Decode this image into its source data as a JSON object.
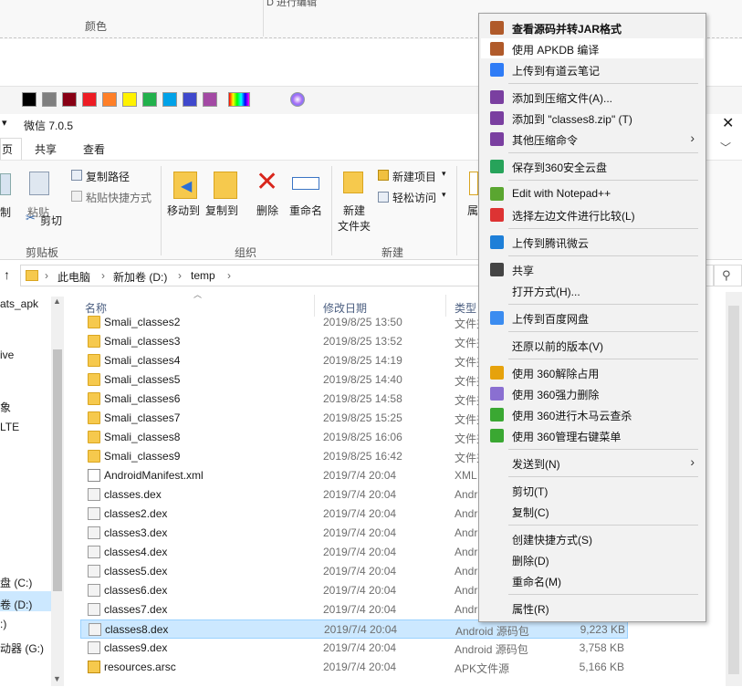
{
  "paint": {
    "colors_label": "颜色",
    "edit3d_label": "D 进行编辑",
    "palette": [
      "#000000",
      "#7f7f7f",
      "#880015",
      "#ed1c24",
      "#ff7f27",
      "#fff200",
      "#22b14c",
      "#00a2e8",
      "#3f48cc",
      "#a349a4"
    ]
  },
  "explorer": {
    "title": "微信 7.0.5",
    "tabs": [
      "页",
      "共享",
      "查看"
    ],
    "ribbon": {
      "clipboard": {
        "pin_label": "制",
        "paste_label": "粘贴",
        "copy_path": "复制路径",
        "paste_shortcut": "粘贴快捷方式",
        "cut": "剪切",
        "group": "剪贴板"
      },
      "organize": {
        "move_to": "移动到",
        "copy_to": "复制到",
        "delete": "删除",
        "rename": "重命名",
        "group": "组织"
      },
      "new": {
        "new_folder": [
          "新建",
          "文件夹"
        ],
        "new_item": "新建项目",
        "easy_access": "轻松访问",
        "group": "新建",
        "prop_label": "属"
      }
    },
    "address": {
      "crumbs": [
        "此电脑",
        "新加卷 (D:)",
        "temp"
      ]
    },
    "nav": [
      "ats_apk",
      "ive",
      "象",
      "LTE",
      "盘 (C:)",
      "卷 (D:)",
      ":)",
      "动器 (G:)"
    ],
    "columns": {
      "name": "名称",
      "date": "修改日期",
      "type": "类型"
    },
    "files": [
      {
        "name": "Smali_classes2",
        "date": "2019/8/25 13:50",
        "type": "文件夹",
        "size": "",
        "kind": "folder"
      },
      {
        "name": "Smali_classes3",
        "date": "2019/8/25 13:52",
        "type": "文件夹",
        "size": "",
        "kind": "folder"
      },
      {
        "name": "Smali_classes4",
        "date": "2019/8/25 14:19",
        "type": "文件夹",
        "size": "",
        "kind": "folder"
      },
      {
        "name": "Smali_classes5",
        "date": "2019/8/25 14:40",
        "type": "文件夹",
        "size": "",
        "kind": "folder"
      },
      {
        "name": "Smali_classes6",
        "date": "2019/8/25 14:58",
        "type": "文件夹",
        "size": "",
        "kind": "folder"
      },
      {
        "name": "Smali_classes7",
        "date": "2019/8/25 15:25",
        "type": "文件夹",
        "size": "",
        "kind": "folder"
      },
      {
        "name": "Smali_classes8",
        "date": "2019/8/25 16:06",
        "type": "文件夹",
        "size": "",
        "kind": "folder"
      },
      {
        "name": "Smali_classes9",
        "date": "2019/8/25 16:42",
        "type": "文件夹",
        "size": "",
        "kind": "folder"
      },
      {
        "name": "AndroidManifest.xml",
        "date": "2019/7/4 20:04",
        "type": "XML",
        "size": "",
        "kind": "xml"
      },
      {
        "name": "classes.dex",
        "date": "2019/7/4 20:04",
        "type": "Andr",
        "size": "",
        "kind": "file"
      },
      {
        "name": "classes2.dex",
        "date": "2019/7/4 20:04",
        "type": "Andr",
        "size": "",
        "kind": "file"
      },
      {
        "name": "classes3.dex",
        "date": "2019/7/4 20:04",
        "type": "Andr",
        "size": "",
        "kind": "file"
      },
      {
        "name": "classes4.dex",
        "date": "2019/7/4 20:04",
        "type": "Andr",
        "size": "",
        "kind": "file"
      },
      {
        "name": "classes5.dex",
        "date": "2019/7/4 20:04",
        "type": "Andr",
        "size": "",
        "kind": "file"
      },
      {
        "name": "classes6.dex",
        "date": "2019/7/4 20:04",
        "type": "Andr",
        "size": "",
        "kind": "file"
      },
      {
        "name": "classes7.dex",
        "date": "2019/7/4 20:04",
        "type": "Andr",
        "size": "",
        "kind": "file"
      },
      {
        "name": "classes8.dex",
        "date": "2019/7/4 20:04",
        "type": "Android 源码包",
        "size": "9,223 KB",
        "kind": "file",
        "selected": true
      },
      {
        "name": "classes9.dex",
        "date": "2019/7/4 20:04",
        "type": "Android 源码包",
        "size": "3,758 KB",
        "kind": "file"
      },
      {
        "name": "resources.arsc",
        "date": "2019/7/4 20:04",
        "type": "APK文件源",
        "size": "5,166 KB",
        "kind": "zip"
      }
    ]
  },
  "context_menu": {
    "items": [
      {
        "label": "查看源码并转JAR格式",
        "icon": "decompile-icon",
        "icon_color": "#b05a2a",
        "bold": true
      },
      {
        "label": "使用 APKDB 编译",
        "icon": "compile-icon",
        "icon_color": "#b05a2a",
        "hover": true
      },
      {
        "label": "上传到有道云笔记",
        "icon": "youdao-note-icon",
        "icon_color": "#2f7cf6"
      },
      {
        "sep": true
      },
      {
        "label": "添加到压缩文件(A)...",
        "icon": "winrar-icon",
        "icon_color": "#7a3fa0"
      },
      {
        "label": "添加到 \"classes8.zip\" (T)",
        "icon": "winrar-icon",
        "icon_color": "#7a3fa0"
      },
      {
        "label": "其他压缩命令",
        "icon": "winrar-icon",
        "icon_color": "#7a3fa0",
        "submenu": true
      },
      {
        "sep": true
      },
      {
        "label": "保存到360安全云盘",
        "icon": "cloud360-icon",
        "icon_color": "#27a35a"
      },
      {
        "sep": true
      },
      {
        "label": "Edit with Notepad++",
        "icon": "notepadpp-icon",
        "icon_color": "#5aa630"
      },
      {
        "label": "选择左边文件进行比较(L)",
        "icon": "compare-icon",
        "icon_color": "#d33"
      },
      {
        "sep": true
      },
      {
        "label": "上传到腾讯微云",
        "icon": "weiyun-icon",
        "icon_color": "#1e7fd8"
      },
      {
        "sep": true
      },
      {
        "label": "共享",
        "icon": "share-icon",
        "icon_color": "#444"
      },
      {
        "label": "打开方式(H)...",
        "icon": "",
        "icon_color": ""
      },
      {
        "sep": true
      },
      {
        "label": "上传到百度网盘",
        "icon": "baidu-pan-icon",
        "icon_color": "#3b8cf0"
      },
      {
        "sep": true
      },
      {
        "label": "还原以前的版本(V)",
        "icon": "",
        "icon_color": ""
      },
      {
        "sep": true
      },
      {
        "label": "使用 360解除占用",
        "icon": "unlock360-icon",
        "icon_color": "#e6a20c"
      },
      {
        "label": "使用 360强力删除",
        "icon": "shred360-icon",
        "icon_color": "#8a6fd1"
      },
      {
        "label": "使用 360进行木马云查杀",
        "icon": "scan360-icon",
        "icon_color": "#3aa832"
      },
      {
        "label": "使用 360管理右键菜单",
        "icon": "menu360-icon",
        "icon_color": "#3aa832"
      },
      {
        "sep": true
      },
      {
        "label": "发送到(N)",
        "icon": "",
        "icon_color": "",
        "submenu": true
      },
      {
        "sep": true
      },
      {
        "label": "剪切(T)",
        "icon": "",
        "icon_color": ""
      },
      {
        "label": "复制(C)",
        "icon": "",
        "icon_color": ""
      },
      {
        "sep": true
      },
      {
        "label": "创建快捷方式(S)",
        "icon": "",
        "icon_color": ""
      },
      {
        "label": "删除(D)",
        "icon": "",
        "icon_color": ""
      },
      {
        "label": "重命名(M)",
        "icon": "",
        "icon_color": ""
      },
      {
        "sep": true
      },
      {
        "label": "属性(R)",
        "icon": "",
        "icon_color": ""
      }
    ]
  }
}
